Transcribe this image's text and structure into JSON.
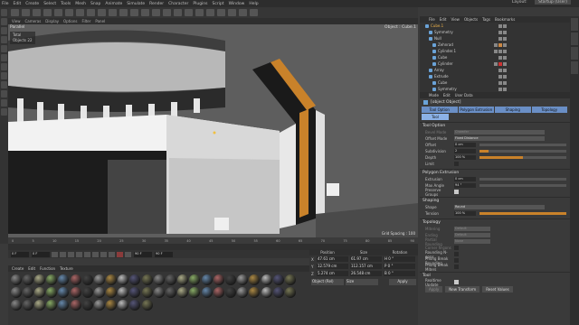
{
  "menubar": {
    "items": [
      "File",
      "Edit",
      "Create",
      "Select",
      "Tools",
      "Mesh",
      "Snap",
      "Animate",
      "Simulate",
      "Render",
      "Character",
      "Plugins",
      "Script",
      "Window",
      "Help"
    ],
    "layout_label": "Layout:",
    "layout_value": "Startup (User)"
  },
  "viewport": {
    "menu": [
      "View",
      "Cameras",
      "Display",
      "Options",
      "Filter",
      "Panel"
    ],
    "label": "Parallel",
    "camera": "Object : Cube.1",
    "stats_total": "Total",
    "stats_objects_label": "Objects",
    "stats_objects": "22",
    "grid_spacing": "Grid Spacing : 100"
  },
  "timeline": {
    "ticks": [
      "0",
      "5",
      "10",
      "15",
      "20",
      "25",
      "30",
      "35",
      "40",
      "45",
      "50",
      "55",
      "60",
      "65",
      "70",
      "75",
      "80",
      "85",
      "90"
    ],
    "start": "0 F",
    "current": "0 F",
    "end": "90 F",
    "max": "90 F"
  },
  "materials": {
    "menu": [
      "Create",
      "Edit",
      "Function",
      "Texture"
    ],
    "count": 60
  },
  "coords": {
    "headers": [
      "Position",
      "Size",
      "Rotation"
    ],
    "rows": [
      {
        "axis": "X",
        "pos": "47.61 cm",
        "size": "61.97 cm",
        "rot": "H 0 °"
      },
      {
        "axis": "Y",
        "pos": "12.579 cm",
        "size": "112.157 cm",
        "rot": "P 0 °"
      },
      {
        "axis": "Z",
        "pos": "5.274 cm",
        "size": "26.548 cm",
        "rot": "B 0 °"
      }
    ],
    "mode": "Object (Rel)",
    "size_mode": "Size",
    "apply": "Apply"
  },
  "objects": {
    "menu": [
      "File",
      "Edit",
      "View",
      "Objects",
      "Tags",
      "Bookmarks"
    ],
    "items": [
      "Cube.1",
      "Symmetry",
      "Null",
      "Zehnrad",
      "Cylinder.1",
      "Cube",
      "Cylinder",
      "Array",
      "Extrude",
      "Cube",
      "Symmetry"
    ]
  },
  "attributes": {
    "menu": [
      "Mode",
      "Edit",
      "User Data"
    ],
    "tool": {
      "title": "Tool",
      "realtime": {
        "label": "Realtime Update"
      },
      "apply": "Apply",
      "new_transform": "New Transform",
      "reset": "Reset Values"
    },
    "tabs": [
      "Tool Option",
      "Polygon Extrusion",
      "Shaping",
      "Topology"
    ],
    "tab2": "Tool",
    "tool_option": {
      "title": "Tool Option",
      "bevel_mode": {
        "label": "Bevel Mode",
        "value": "Chamfer"
      },
      "offset_mode": {
        "label": "Offset Mode",
        "value": "Fixed Distance"
      },
      "offset": {
        "label": "Offset",
        "value": "0 cm"
      },
      "subdivision": {
        "label": "Subdivision",
        "value": "2",
        "fill": 0.1
      },
      "depth": {
        "label": "Depth",
        "value": "100 %",
        "fill": 0.5
      },
      "limit": {
        "label": "Limit"
      }
    },
    "polygon_extrusion": {
      "title": "Polygon Extrusion",
      "extrusion": {
        "label": "Extrusion",
        "value": "0 cm"
      },
      "max_angle": {
        "label": "Max Angle",
        "value": "94 °"
      },
      "preserve_groups": {
        "label": "Preserve Groups"
      }
    },
    "shaping": {
      "title": "Shaping",
      "shape": {
        "label": "Shape",
        "value": "Round"
      },
      "tension": {
        "label": "Tension",
        "value": "100 %",
        "fill": 1
      }
    },
    "topology": {
      "title": "Topology",
      "mitering": {
        "label": "Mitering",
        "value": "Default"
      },
      "ending": {
        "label": "Ending",
        "value": "Default"
      },
      "partial_rounding": {
        "label": "Partial Rounding",
        "value": "None"
      },
      "corner_ngons": {
        "label": "Corner N-gons"
      },
      "rounding_ngons": {
        "label": "Rounding N-gons"
      },
      "phong_break_rounding": {
        "label": "Phong Break Rounding"
      },
      "phong_break_miters": {
        "label": "Phong Break Miters"
      }
    }
  }
}
